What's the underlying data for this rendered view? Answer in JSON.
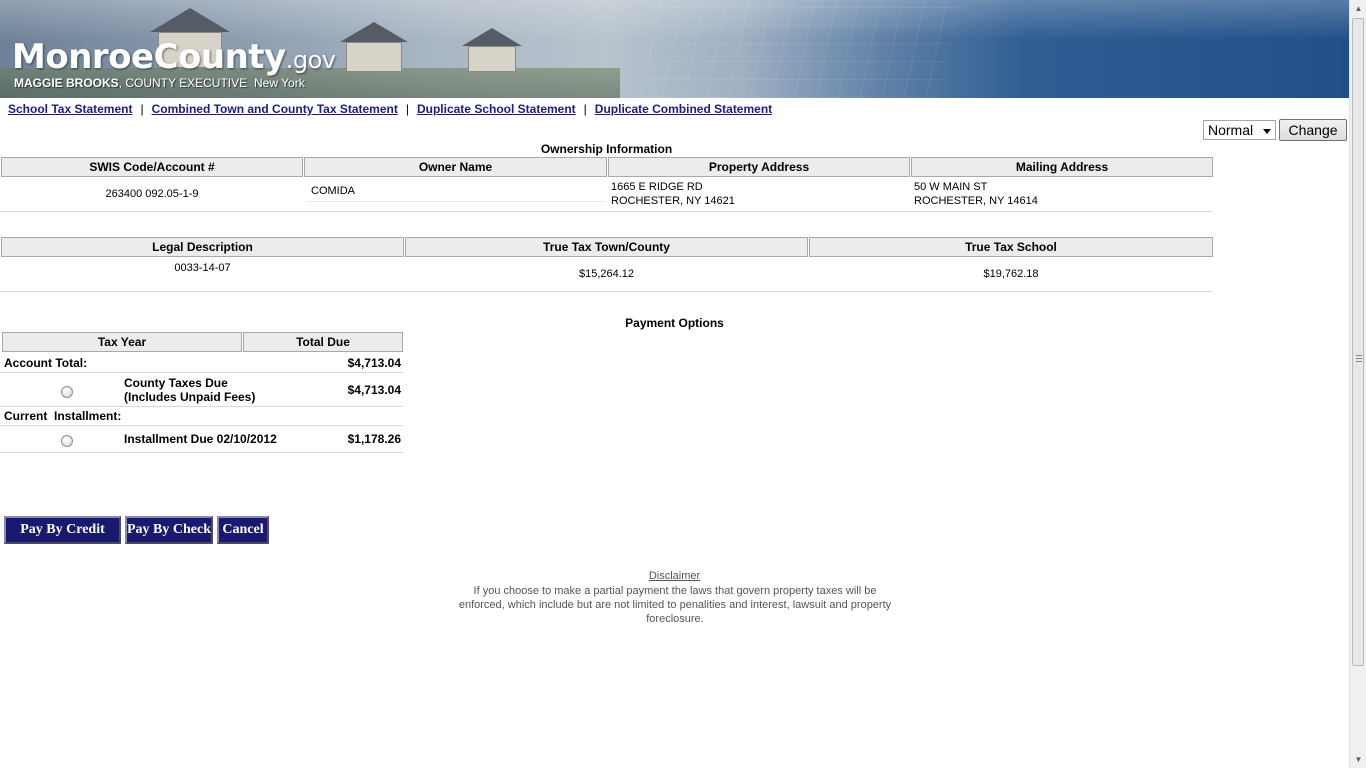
{
  "banner": {
    "logo_main": "MonroeCounty",
    "logo_gov": ".gov",
    "executive_name": "MAGGIE BROOKS",
    "executive_title": ", COUNTY EXECUTIVE",
    "state": "New York"
  },
  "nav_links": [
    {
      "label": "School Tax Statement"
    },
    {
      "label": "Combined Town and County Tax Statement"
    },
    {
      "label": "Duplicate School Statement"
    },
    {
      "label": "Duplicate Combined Statement"
    }
  ],
  "nav_separator": "|",
  "view_control": {
    "selected": "Normal",
    "button_label": "Change"
  },
  "ownership": {
    "caption": "Ownership Information",
    "headers": [
      "SWIS Code/Account #",
      "Owner Name",
      "Property Address",
      "Mailing Address"
    ],
    "swis_account": "263400 092.05-1-9",
    "owner_name": "COMIDA",
    "property_address_line1": "1665 E RIDGE RD",
    "property_address_line2": "ROCHESTER, NY 14621",
    "mailing_address_line1": "50 W MAIN ST",
    "mailing_address_line2": "ROCHESTER, NY 14614"
  },
  "tax_info": {
    "headers": [
      "Legal Description",
      "True Tax Town/County",
      "True Tax School"
    ],
    "legal_description": "0033-14-07",
    "true_tax_town_county": "$15,264.12",
    "true_tax_school": "$19,762.18"
  },
  "payment_options": {
    "caption": "Payment Options",
    "headers": [
      "Tax Year",
      "Total Due"
    ],
    "account_total_label": "Account Total:",
    "account_total_value": "$4,713.04",
    "county_taxes_line1": "County Taxes Due",
    "county_taxes_line2": "(Includes Unpaid Fees)",
    "county_taxes_value": "$4,713.04",
    "current_installment_label": "Current  Installment:",
    "installment_label": "Installment Due 02/10/2012",
    "installment_value": "$1,178.26"
  },
  "buttons": {
    "credit_card": "Pay By Credit Card",
    "check": "Pay By Check",
    "cancel": "Cancel"
  },
  "disclaimer": {
    "title": "Disclaimer",
    "text": "If you choose to make a partial payment the laws that govern property taxes will be enforced, which include but are not limited to penalities and interest, lawsuit and property foreclosure."
  },
  "colors": {
    "banner_blue": "#215089",
    "link_color": "#1a1a8c",
    "button_navy": "#191970",
    "header_bg": "#ececec"
  }
}
